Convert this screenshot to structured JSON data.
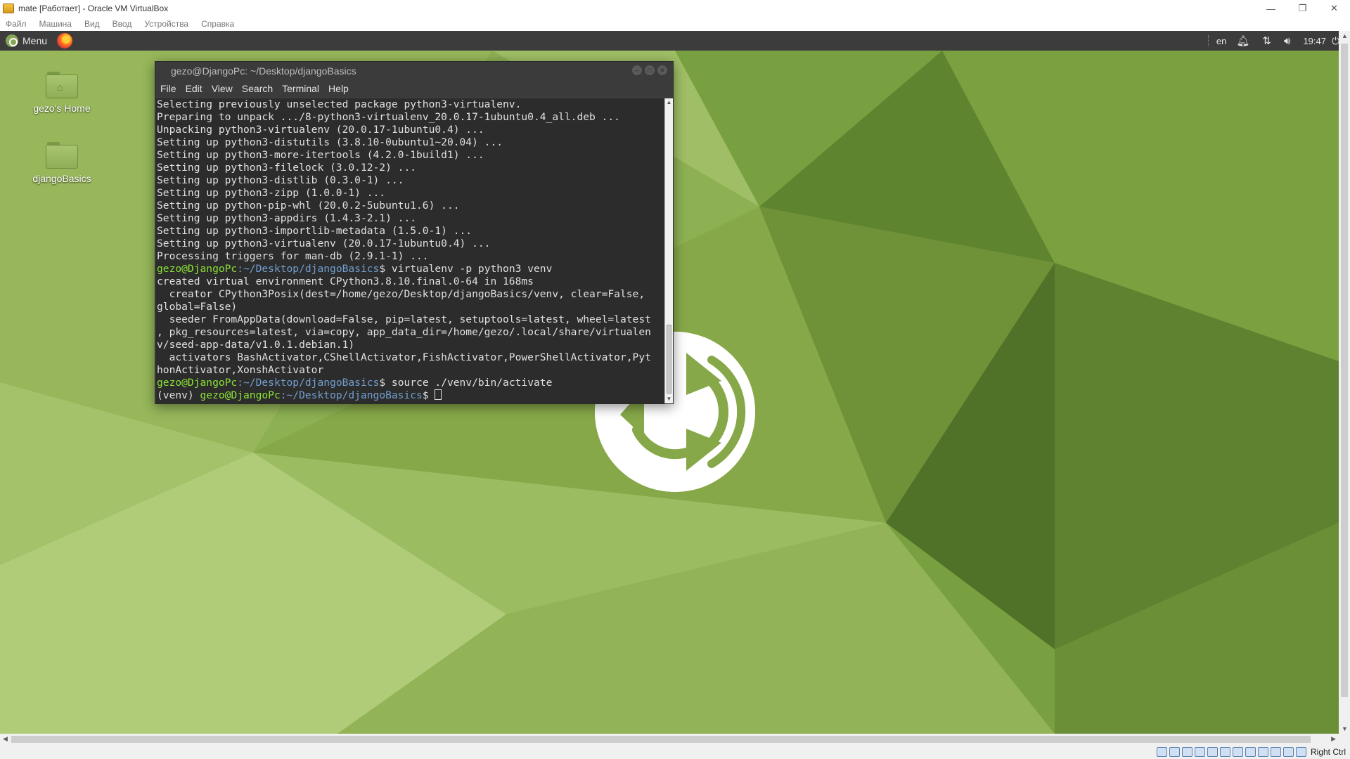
{
  "host_window": {
    "title": "mate [Работает] - Oracle VM VirtualBox",
    "controls": [
      "—",
      "❐",
      "✕"
    ]
  },
  "host_menu": [
    "Файл",
    "Машина",
    "Вид",
    "Ввод",
    "Устройства",
    "Справка"
  ],
  "guest_panel": {
    "menu_label": "Menu",
    "lang": "en",
    "clock": "19:47"
  },
  "desktop_icons": [
    {
      "label": "gezo's Home",
      "icon": "home-folder-icon"
    },
    {
      "label": "djangoBasics",
      "icon": "folder-icon"
    }
  ],
  "terminal": {
    "title": "gezo@DjangoPc: ~/Desktop/djangoBasics",
    "menu": [
      "File",
      "Edit",
      "View",
      "Search",
      "Terminal",
      "Help"
    ],
    "lines": [
      "Selecting previously unselected package python3-virtualenv.",
      "Preparing to unpack .../8-python3-virtualenv_20.0.17-1ubuntu0.4_all.deb ...",
      "Unpacking python3-virtualenv (20.0.17-1ubuntu0.4) ...",
      "Setting up python3-distutils (3.8.10-0ubuntu1~20.04) ...",
      "Setting up python3-more-itertools (4.2.0-1build1) ...",
      "Setting up python3-filelock (3.0.12-2) ...",
      "Setting up python3-distlib (0.3.0-1) ...",
      "Setting up python3-zipp (1.0.0-1) ...",
      "Setting up python-pip-whl (20.0.2-5ubuntu1.6) ...",
      "Setting up python3-appdirs (1.4.3-2.1) ...",
      "Setting up python3-importlib-metadata (1.5.0-1) ...",
      "Setting up python3-virtualenv (20.0.17-1ubuntu0.4) ...",
      "Processing triggers for man-db (2.9.1-1) ..."
    ],
    "prompt_user": "gezo@DjangoPc",
    "prompt_path": ":~/Desktop/djangoBasics",
    "prompt_sign": "$",
    "cmd1": " virtualenv -p python3 venv",
    "output1": [
      "created virtual environment CPython3.8.10.final.0-64 in 168ms",
      "  creator CPython3Posix(dest=/home/gezo/Desktop/djangoBasics/venv, clear=False,",
      "global=False)",
      "  seeder FromAppData(download=False, pip=latest, setuptools=latest, wheel=latest",
      ", pkg_resources=latest, via=copy, app_data_dir=/home/gezo/.local/share/virtualen",
      "v/seed-app-data/v1.0.1.debian.1)",
      "  activators BashActivator,CShellActivator,FishActivator,PowerShellActivator,Pyt",
      "honActivator,XonshActivator"
    ],
    "cmd2": " source ./venv/bin/activate",
    "venv_prefix": "(venv) "
  },
  "statusbar": {
    "host_key": "Right Ctrl"
  }
}
